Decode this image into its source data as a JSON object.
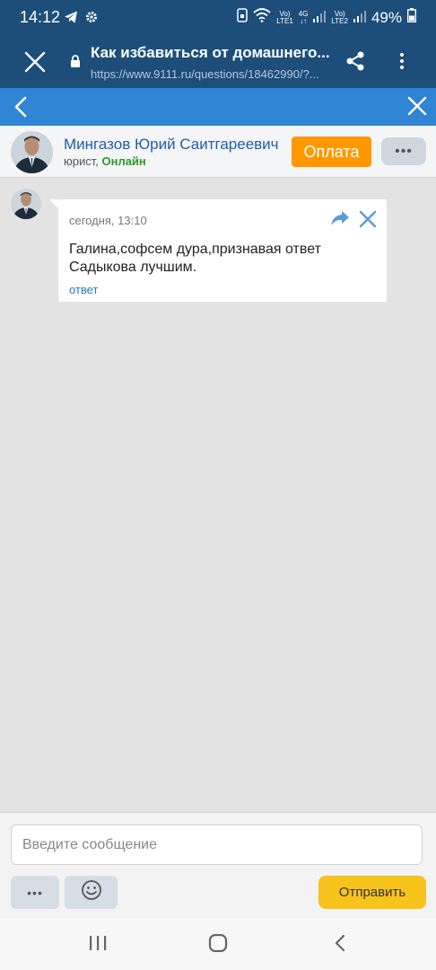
{
  "status_bar": {
    "time": "14:12",
    "network_1_top": "Vo)",
    "network_1_bottom": "LTE1",
    "network_mid": "4G",
    "network_2_top": "Vo)",
    "network_2_bottom": "LTE2",
    "battery": "49%"
  },
  "browser": {
    "title": "Как избавиться от домашнего...",
    "url": "https://www.9111.ru/questions/18462990/?..."
  },
  "lawyer": {
    "name": "Мингазов Юрий Саитгареевич",
    "role": "юрист, ",
    "status": "Онлайн",
    "pay_label": "Оплата",
    "more_label": "•••"
  },
  "message": {
    "timestamp": "сегодня, 13:10",
    "text": "Галина,софсем дура,признавая ответ Садыкова лучшим.",
    "reply_label": "ответ"
  },
  "composer": {
    "placeholder": "Введите сообщение",
    "dots_label": "•••",
    "send_label": "Отправить"
  },
  "colors": {
    "status_bg": "#1d4e7a",
    "chat_header": "#2f84d4",
    "pay": "#ff9800",
    "send": "#f7c31c",
    "online": "#2a9a2a"
  }
}
